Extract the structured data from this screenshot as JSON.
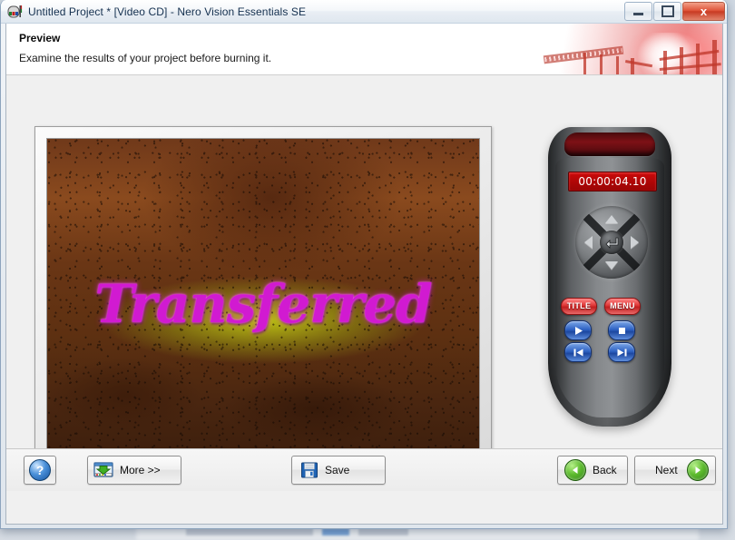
{
  "window": {
    "title": "Untitled Project * [Video CD] - Nero Vision Essentials SE",
    "app_icon": "nero-vision-icon",
    "minimize_label": "Minimize",
    "maximize_label": "Maximize",
    "close_label": "x"
  },
  "header": {
    "title": "Preview",
    "subtitle": "Examine the results of your project before burning it.",
    "artwork": "film-bridge-banner"
  },
  "preview": {
    "caption": "Transferred",
    "caption_color": "#d11ad1",
    "background_colors": [
      "#8a4a1e",
      "#c4ce14",
      "#3a1d0c"
    ]
  },
  "remote": {
    "time_display": "00:00:04.10",
    "time_display_color": "#b00707",
    "dpad": {
      "up": "dpad-up",
      "down": "dpad-down",
      "left": "dpad-left",
      "right": "dpad-right",
      "enter": "enter-arrow-icon"
    },
    "buttons": {
      "title": "TITLE",
      "menu": "MENU",
      "play": "play-icon",
      "stop": "stop-icon",
      "previous": "previous-track-icon",
      "next": "next-track-icon"
    },
    "accent_red": "#c01f1f",
    "accent_blue": "#2f63c4"
  },
  "footer": {
    "help_label": "?",
    "more_label": "More >>",
    "save_label": "Save",
    "back_label": "Back",
    "next_label": "Next"
  }
}
